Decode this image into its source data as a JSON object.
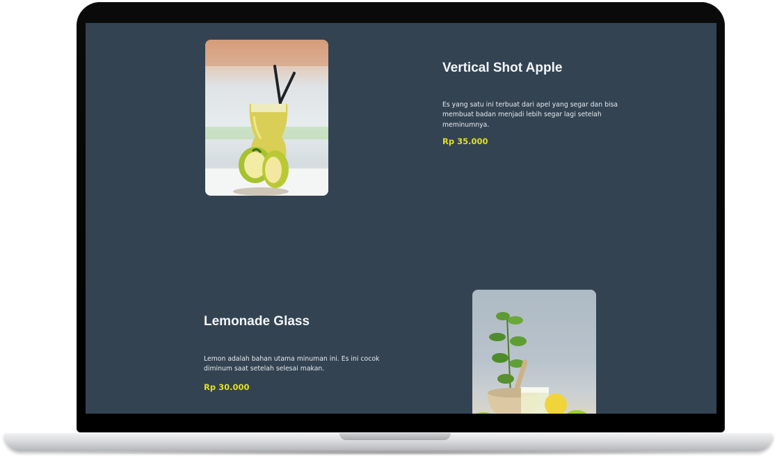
{
  "products": [
    {
      "title": "Vertical Shot Apple",
      "description": "Es yang satu ini terbuat dari apel yang  segar dan bisa membuat badan menjadi lebih segar lagi setelah meminumnya.",
      "price": "Rp 35.000",
      "image_icon": "apple-juice-photo"
    },
    {
      "title": "Lemonade Glass",
      "description": "Lemon adalah bahan utama minuman ini. Es ini cocok diminum saat setelah selesai makan.",
      "price": "Rp 30.000",
      "image_icon": "lemonade-photo"
    }
  ],
  "colors": {
    "background": "#334352",
    "title": "#f4f6f8",
    "text": "#e6ebef",
    "price": "#e2df20"
  }
}
